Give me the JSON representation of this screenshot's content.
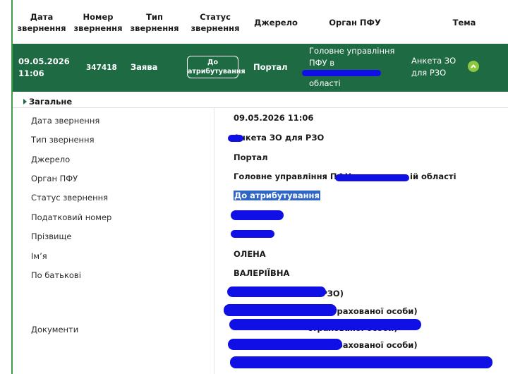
{
  "table": {
    "headers": [
      "Дата\nзвернення",
      "Номер\nзвернення",
      "Тип\nзвернення",
      "Статус\nзвернення",
      "Джерело",
      "Орган ПФУ",
      "Тема"
    ],
    "selected_row": {
      "date": "09.05.2026\n11:06",
      "number": "347418",
      "type": "Заява",
      "status": "До\nатрибутування",
      "source": "Портал",
      "organ_line1": "Головне управління",
      "organ_line2": "ПФУ в",
      "organ_line4": "області",
      "topic": "Анкета ЗО\nдля РЗО"
    }
  },
  "details": {
    "section_title": "Загальне",
    "labels": {
      "date": "Дата звернення",
      "type": "Тип звернення",
      "source": "Джерело",
      "organ": "Орган ПФУ",
      "status": "Статус звернення",
      "tax": "Податковий номер",
      "surname": "Прізвище",
      "name": "Ім’я",
      "patronymic": "По батькові",
      "documents": "Документи"
    },
    "values": {
      "date": "09.05.2026 11:06",
      "type": "Анкета ЗО для РЗО",
      "source": "Портал",
      "organ_start": "Головне управління ПФУ в",
      "organ_end": "ій області",
      "status": "До атрибутування",
      "name": "ОЛЕНА",
      "patronymic": "ВАЛЕРІЇВНА",
      "doc1_tail": "ія РЗО)",
      "doc2_tail": "страхованої особи)",
      "doc3_tail": "страхованої особи)",
      "doc4_tail": "страхованої особи)"
    }
  },
  "colors": {
    "row_selected": "#1e6b43",
    "accent_green": "#8dc63f",
    "redaction": "#1010e6",
    "highlight": "#2f66c6"
  }
}
